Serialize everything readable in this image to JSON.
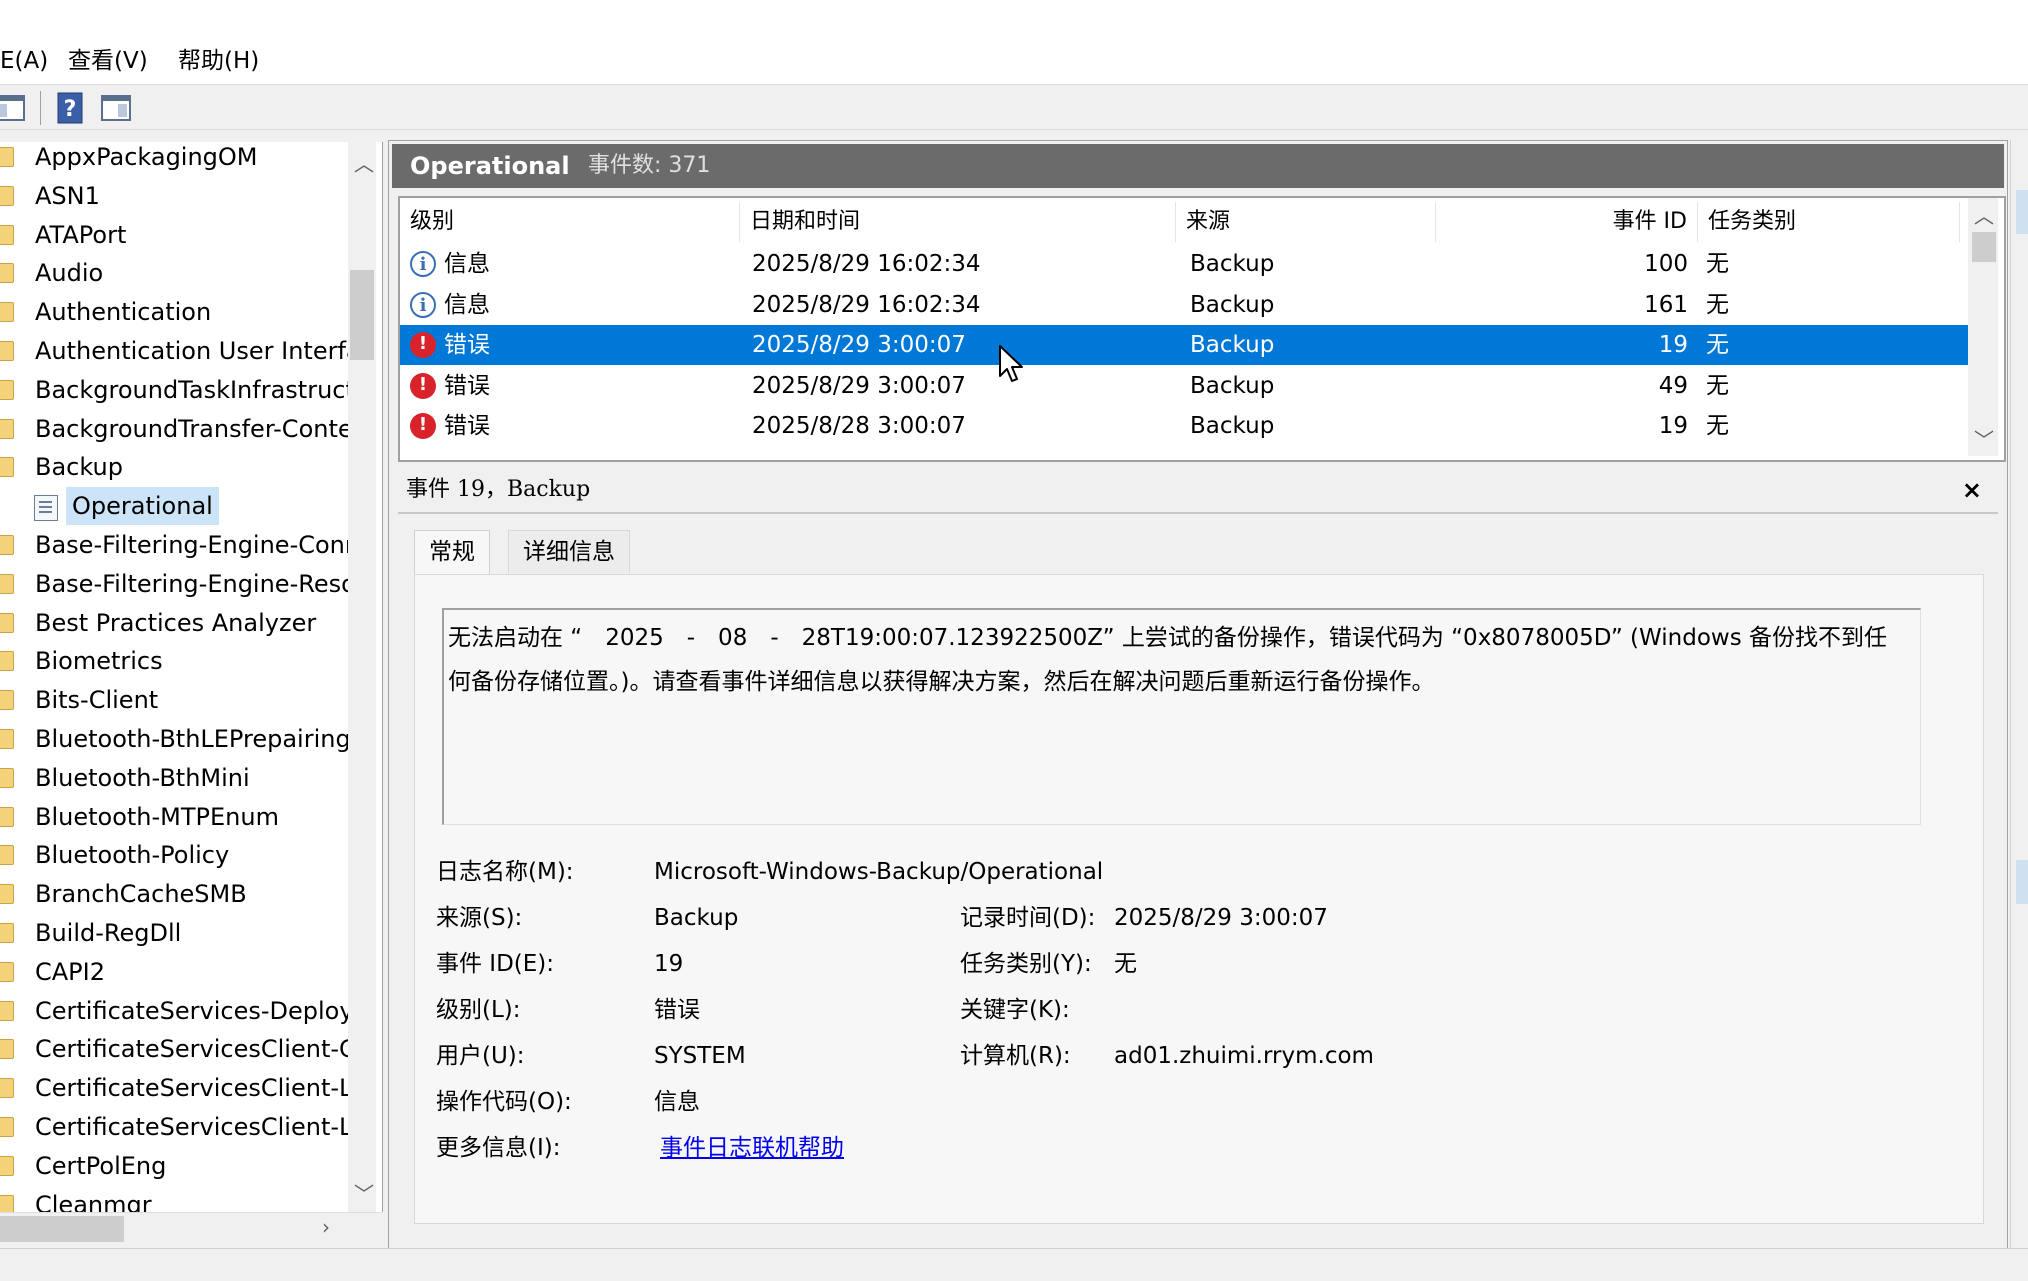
{
  "menu": {
    "items": [
      "E(A)",
      "查看(V)",
      "帮助(H)"
    ]
  },
  "toolbar": {
    "buttons": [
      "show-hide-console-tree-icon",
      "help-icon",
      "show-hide-action-pane-icon"
    ]
  },
  "tree": {
    "items": [
      "AppxPackagingOM",
      "ASN1",
      "ATAPort",
      "Audio",
      "Authentication",
      "Authentication User Interfac",
      "BackgroundTaskInfrastructu",
      "BackgroundTransfer-Conter",
      "Backup",
      "Operational",
      "Base-Filtering-Engine-Conne",
      "Base-Filtering-Engine-Resou",
      "Best Practices Analyzer",
      "Biometrics",
      "Bits-Client",
      "Bluetooth-BthLEPrepairing",
      "Bluetooth-BthMini",
      "Bluetooth-MTPEnum",
      "Bluetooth-Policy",
      "BranchCacheSMB",
      "Build-RegDll",
      "CAPI2",
      "CertificateServices-Deploym",
      "CertificateServicesClient-Cre",
      "CertificateServicesClient-Life",
      "CertificateServicesClient-Life",
      "CertPolEng",
      "Cleanmgr"
    ]
  },
  "log": {
    "title": "Operational",
    "count_label": "事件数: 371"
  },
  "list": {
    "columns": [
      "级别",
      "日期和时间",
      "来源",
      "事件 ID",
      "任务类别"
    ],
    "rows": [
      {
        "level": "信息",
        "type": "info",
        "datetime": "2025/8/29 16:02:34",
        "source": "Backup",
        "event_id": "100",
        "task": "无"
      },
      {
        "level": "信息",
        "type": "info",
        "datetime": "2025/8/29 16:02:34",
        "source": "Backup",
        "event_id": "161",
        "task": "无"
      },
      {
        "level": "错误",
        "type": "error",
        "datetime": "2025/8/29 3:00:07",
        "source": "Backup",
        "event_id": "19",
        "task": "无"
      },
      {
        "level": "错误",
        "type": "error",
        "datetime": "2025/8/29 3:00:07",
        "source": "Backup",
        "event_id": "49",
        "task": "无"
      },
      {
        "level": "错误",
        "type": "error",
        "datetime": "2025/8/28 3:00:07",
        "source": "Backup",
        "event_id": "19",
        "task": "无"
      }
    ],
    "selected_index": 2
  },
  "detail": {
    "title": "事件 19，Backup",
    "close": "×",
    "tabs": [
      "常规",
      "详细信息"
    ],
    "message": "无法启动在 “　2025　-　08　-　28T19:00:07.123922500Z” 上尝试的备份操作，错误代码为 “0x8078005D” (Windows 备份找不到任何备份存储位置。)。请查看事件详细信息以获得解决方案，然后在解决问题后重新运行备份操作。",
    "labels": {
      "log_name": "日志名称(M):",
      "source": "来源(S):",
      "event_id": "事件 ID(E):",
      "level": "级别(L):",
      "user": "用户(U):",
      "opcode": "操作代码(O):",
      "more_info": "更多信息(I):",
      "logged": "记录时间(D):",
      "task": "任务类别(Y):",
      "keywords": "关键字(K):",
      "computer": "计算机(R):"
    },
    "values": {
      "log_name": "Microsoft-Windows-Backup/Operational",
      "source": "Backup",
      "event_id": "19",
      "level": "错误",
      "user": "SYSTEM",
      "opcode": "信息",
      "more_info": "事件日志联机帮助",
      "logged": "2025/8/29 3:00:07",
      "task": "无",
      "keywords": "",
      "computer": "ad01.zhuimi.rrym.com"
    }
  },
  "colors": {
    "selection": "#0078d7",
    "header_bar": "#6b6b6b",
    "error_icon": "#d9222a",
    "info_icon": "#3a6fb5",
    "link": "#0000ee"
  }
}
